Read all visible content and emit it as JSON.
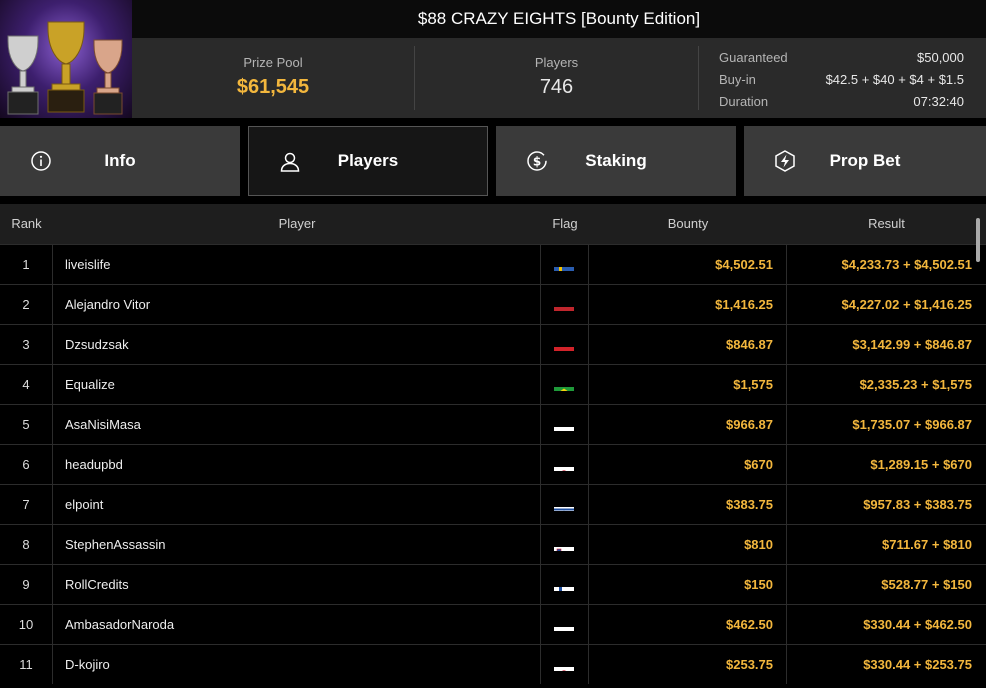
{
  "header": {
    "title": "$88 CRAZY EIGHTS [Bounty Edition]",
    "prize_pool_label": "Prize Pool",
    "prize_pool_value": "$61,545",
    "players_label": "Players",
    "players_value": "746",
    "guaranteed_label": "Guaranteed",
    "guaranteed_value": "$50,000",
    "buyin_label": "Buy-in",
    "buyin_value": "$42.5 + $40 + $4 + $1.5",
    "duration_label": "Duration",
    "duration_value": "07:32:40"
  },
  "tabs": [
    {
      "label": "Info",
      "icon": "info-icon"
    },
    {
      "label": "Players",
      "icon": "user-icon"
    },
    {
      "label": "Staking",
      "icon": "dollar-coin-icon"
    },
    {
      "label": "Prop Bet",
      "icon": "lightning-icon"
    }
  ],
  "active_tab": "Players",
  "table": {
    "columns": [
      "Rank",
      "Player",
      "Flag",
      "Bounty",
      "Result"
    ],
    "rows": [
      {
        "rank": "1",
        "player": "liveislife",
        "flag": "sweden",
        "bounty": "$4,502.51",
        "result": "$4,233.73 + $4,502.51"
      },
      {
        "rank": "2",
        "player": "Alejandro Vitor",
        "flag": "netherlands",
        "bounty": "$1,416.25",
        "result": "$4,227.02 + $1,416.25"
      },
      {
        "rank": "3",
        "player": "Dzsudzsak",
        "flag": "austria",
        "bounty": "$846.87",
        "result": "$3,142.99 + $846.87"
      },
      {
        "rank": "4",
        "player": "Equalize",
        "flag": "brazil",
        "bounty": "$1,575",
        "result": "$2,335.23 + $1,575"
      },
      {
        "rank": "5",
        "player": "AsaNisiMasa",
        "flag": "poland",
        "bounty": "$966.87",
        "result": "$1,735.07 + $966.87"
      },
      {
        "rank": "6",
        "player": "headupbd",
        "flag": "japan",
        "bounty": "$670",
        "result": "$1,289.15 + $670"
      },
      {
        "rank": "7",
        "player": "elpoint",
        "flag": "israel",
        "bounty": "$383.75",
        "result": "$957.83 + $383.75"
      },
      {
        "rank": "8",
        "player": "StephenAssassin",
        "flag": "slovenia",
        "bounty": "$810",
        "result": "$711.67 + $810"
      },
      {
        "rank": "9",
        "player": "RollCredits",
        "flag": "finland",
        "bounty": "$150",
        "result": "$528.77 + $150"
      },
      {
        "rank": "10",
        "player": "AmbasadorNaroda",
        "flag": "russia",
        "bounty": "$462.50",
        "result": "$330.44 + $462.50"
      },
      {
        "rank": "11",
        "player": "D-kojiro",
        "flag": "japan",
        "bounty": "$253.75",
        "result": "$330.44 + $253.75"
      }
    ]
  },
  "colors": {
    "accent_gold": "#f3b73d",
    "tab_bg": "#3a3a3a",
    "tab_active_bg": "#161616",
    "stats_bg": "#2a2a2a"
  }
}
